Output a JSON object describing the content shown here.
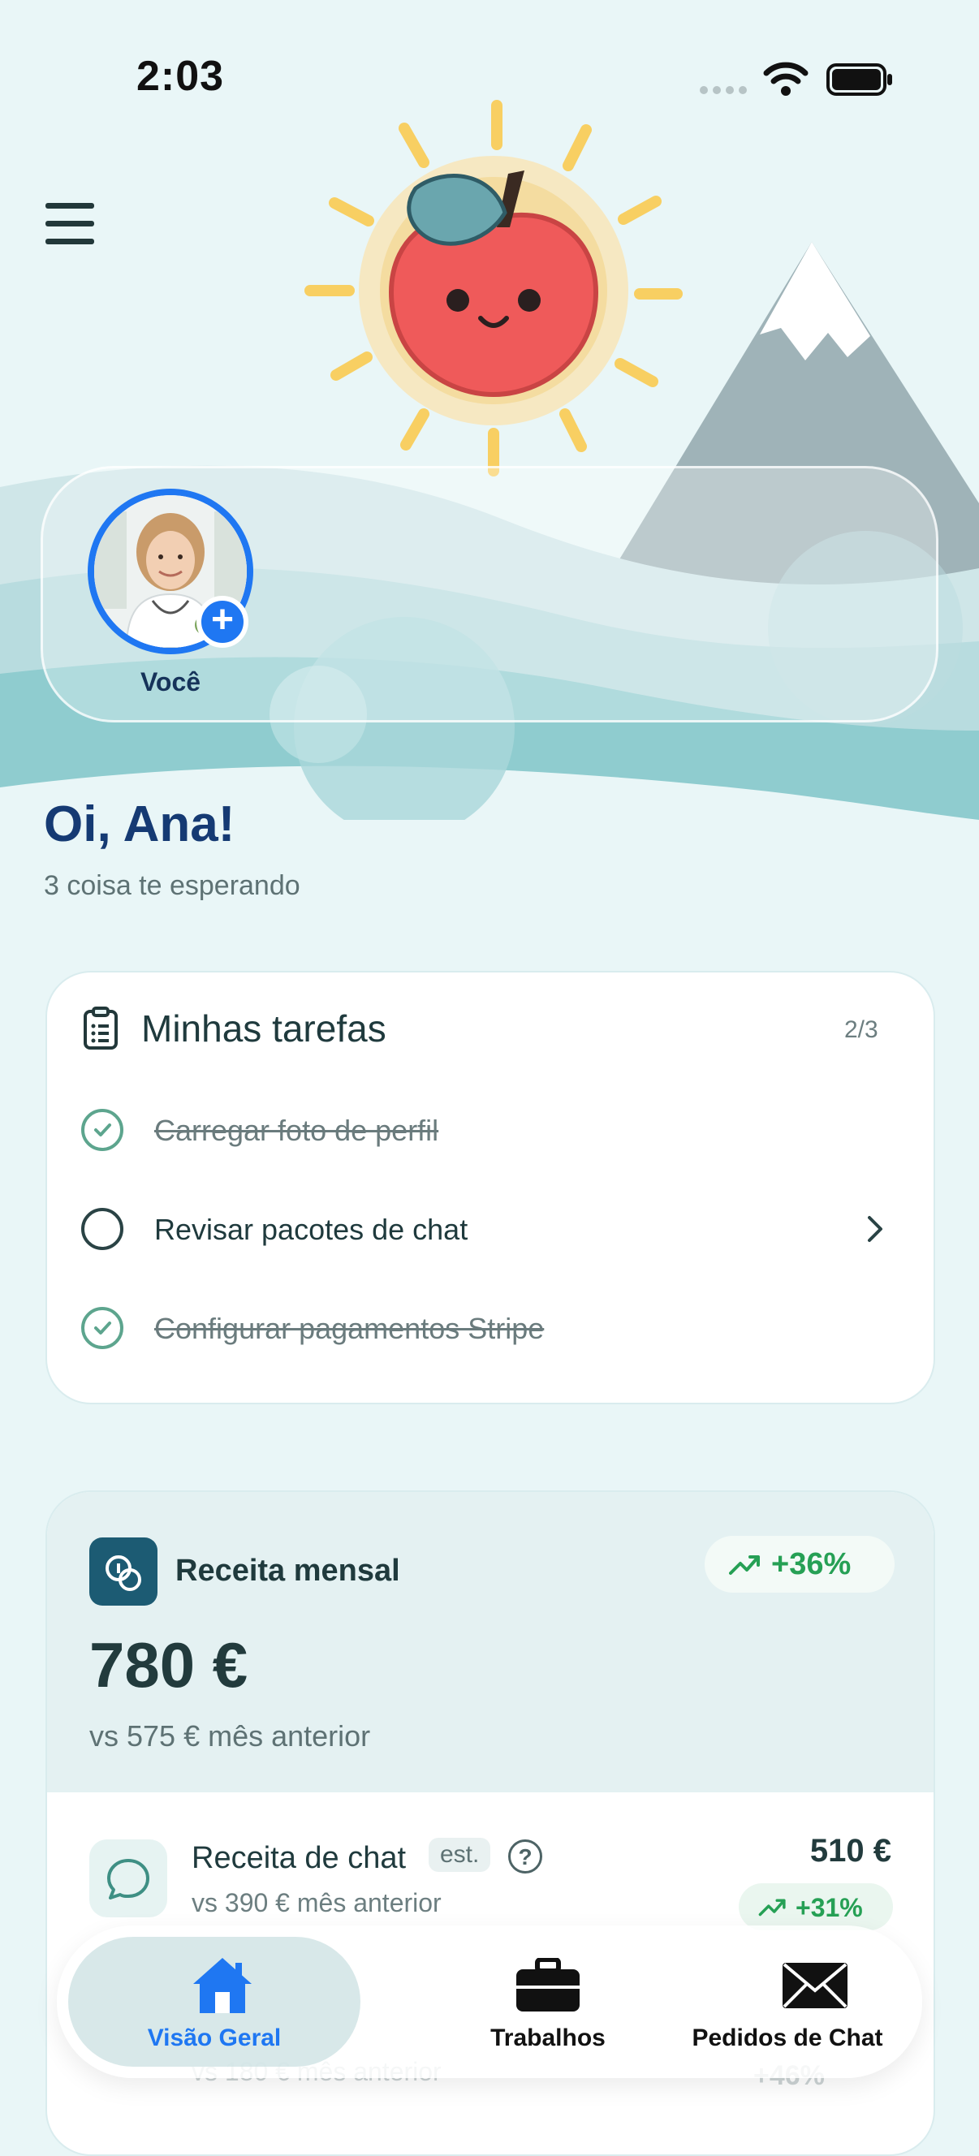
{
  "status_bar": {
    "time": "2:03"
  },
  "stories": {
    "user_label": "Você",
    "add_symbol": "+"
  },
  "greeting": {
    "title": "Oi, Ana!",
    "subtitle": "3 coisa te esperando"
  },
  "tasks": {
    "title": "Minhas tarefas",
    "count": "2/3",
    "items": [
      {
        "label": "Carregar foto de perfil",
        "done": true
      },
      {
        "label": "Revisar pacotes de chat",
        "done": false
      },
      {
        "label": "Configurar pagamentos Stripe",
        "done": true
      }
    ]
  },
  "revenue": {
    "title": "Receita mensal",
    "change": "+36%",
    "amount": "780 €",
    "compare": "vs 575 € mês anterior",
    "chat": {
      "title": "Receita de chat",
      "est": "est.",
      "help": "?",
      "compare": "vs 390 € mês anterior",
      "amount": "510 €",
      "change": "+31%"
    },
    "next": {
      "compare": "vs 180 € mês anterior",
      "change": "+46%"
    }
  },
  "nav": {
    "items": [
      {
        "label": "Visão Geral",
        "icon": "home-icon",
        "active": true
      },
      {
        "label": "Trabalhos",
        "icon": "briefcase-icon",
        "active": false
      },
      {
        "label": "Pedidos de Chat",
        "icon": "envelope-icon",
        "active": false
      }
    ]
  },
  "colors": {
    "primary": "#1f77f2",
    "positive": "#26a055",
    "heading": "#153a73",
    "teal": "#1c5b73"
  }
}
